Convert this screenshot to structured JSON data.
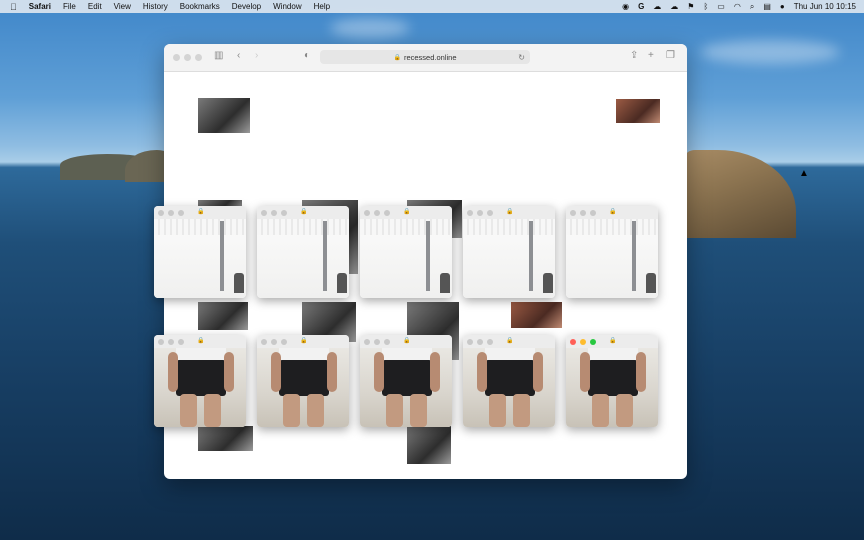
{
  "menubar": {
    "apple_icon": "apple-logo",
    "app_name": "Safari",
    "menus": [
      "File",
      "Edit",
      "View",
      "History",
      "Bookmarks",
      "Develop",
      "Window",
      "Help"
    ],
    "clock": "Thu Jun 10  10:15"
  },
  "browser": {
    "address": "recessed.online"
  }
}
